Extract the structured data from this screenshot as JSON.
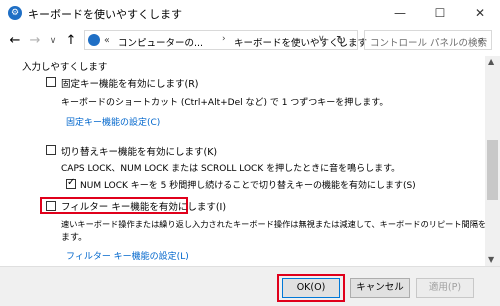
{
  "window": {
    "title": "キーボードを使いやすくします",
    "minimize_glyph": "—",
    "maximize_glyph": "☐",
    "close_glyph": "✕"
  },
  "nav": {
    "back_glyph": "←",
    "forward_glyph": "→",
    "recent_glyph": "∨",
    "up_glyph": "↑",
    "breadcrumb_prefix": "«",
    "breadcrumb": [
      "コンピューターの...",
      "キーボードを使いやすくします"
    ],
    "separator_glyph": "›",
    "dropdown_glyph": "∨",
    "refresh_glyph": "↻",
    "search_placeholder": "コントロール パネルの検索",
    "search_glyph": "⌕"
  },
  "main": {
    "section_title": "入力しやすくします",
    "sticky_keys": {
      "label": "固定キー機能を有効にします(R)",
      "checked": false,
      "description": "キーボードのショートカット (Ctrl+Alt+Del など) で 1 つずつキーを押します。",
      "link": "固定キー機能の設定(C)"
    },
    "toggle_keys": {
      "label": "切り替えキー機能を有効にします(K)",
      "checked": false,
      "description": "CAPS LOCK、NUM LOCK または SCROLL LOCK を押したときに音を鳴らします。",
      "sub_option": {
        "label": "NUM LOCK キーを 5 秒間押し続けることで切り替えキーの機能を有効にします(S)",
        "checked": true
      }
    },
    "filter_keys": {
      "label": "フィルター キー機能を有効にします(I)",
      "checked": false,
      "description_line1": "速いキーボード操作または繰り返し入力されたキーボード操作は無視または減速して、キーボードのリピート間隔を調整し",
      "description_line2": "ます。",
      "link": "フィルター キー機能の設定(L)"
    }
  },
  "scrollbar": {
    "up_glyph": "▲",
    "down_glyph": "▼"
  },
  "footer": {
    "ok_label": "OK(O)",
    "cancel_label": "キャンセル",
    "apply_label": "適用(P)"
  },
  "colors": {
    "accent": "#0078d7",
    "link": "#0066cc",
    "highlight": "#e0001b"
  }
}
